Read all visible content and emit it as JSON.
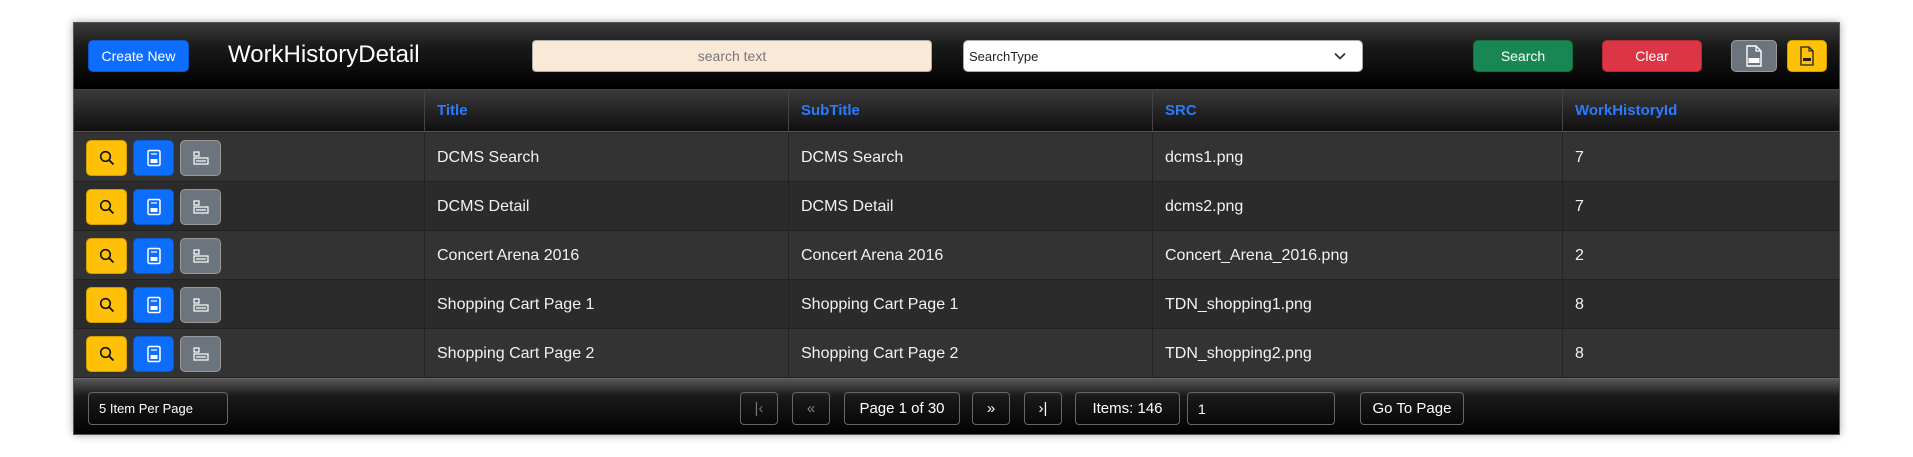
{
  "header": {
    "create_label": "Create New",
    "title": "WorkHistoryDetail",
    "search_placeholder": "search text",
    "search_type_value": "SearchType",
    "search_label": "Search",
    "clear_label": "Clear",
    "csv_icon": "csv-file-icon",
    "pdf_icon": "pdf-file-icon"
  },
  "table": {
    "columns": [
      "Title",
      "SubTitle",
      "SRC",
      "WorkHistoryId"
    ],
    "rows": [
      {
        "title": "DCMS Search",
        "subtitle": "DCMS Search",
        "src": "dcms1.png",
        "id": "7"
      },
      {
        "title": "DCMS Detail",
        "subtitle": "DCMS Detail",
        "src": "dcms2.png",
        "id": "7"
      },
      {
        "title": "Concert Arena 2016",
        "subtitle": "Concert Arena 2016",
        "src": "Concert_Arena_2016.png",
        "id": "2"
      },
      {
        "title": "Shopping Cart Page 1",
        "subtitle": "Shopping Cart Page 1",
        "src": "TDN_shopping1.png",
        "id": "8"
      },
      {
        "title": "Shopping Cart Page 2",
        "subtitle": "Shopping Cart Page 2",
        "src": "TDN_shopping2.png",
        "id": "8"
      }
    ],
    "row_action_icons": [
      "search-icon",
      "edit-icon",
      "detail-icon"
    ]
  },
  "footer": {
    "per_page": "5 Item Per Page",
    "first_glyph": "|‹",
    "prev_glyph": "«",
    "page_label": "Page 1 of 30",
    "next_glyph": "»",
    "last_glyph": "›|",
    "items_label": "Items: 146",
    "page_input_value": "1",
    "go_label": "Go To Page"
  },
  "colors": {
    "primary": "#0d6efd",
    "success": "#198754",
    "danger": "#dc3545",
    "warning": "#ffc107",
    "secondary": "#6c757d",
    "header_text": "#2b7bff"
  }
}
